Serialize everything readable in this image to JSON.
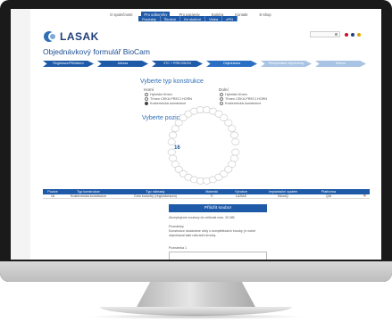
{
  "header": {
    "logo_text": "LASAK",
    "top_nav": [
      {
        "label": "O společnosti",
        "active": false
      },
      {
        "label": "Pro odborníky",
        "active": true
      },
      {
        "label": "Pro pacienty",
        "active": false
      },
      {
        "label": "Kariéra",
        "active": false
      },
      {
        "label": "Kontakt",
        "active": false
      },
      {
        "label": "E-shop",
        "active": false
      }
    ],
    "sub_nav": [
      "Produkty",
      "Školení",
      "Ke stažení",
      "Videa",
      "ePN"
    ],
    "languages": [
      {
        "name": "czech-flag-icon",
        "color": "#c8102e"
      },
      {
        "name": "uk-flag-icon",
        "color": "#1f3f7a"
      },
      {
        "name": "germany-flag-icon",
        "color": "#e2a400"
      }
    ]
  },
  "page_title": "Objednávkový formulář BioCam",
  "steps": [
    {
      "label": "Registrace/Přihlášení",
      "state": "done"
    },
    {
      "label": "Adresa",
      "state": "done"
    },
    {
      "label": "3TC + PRECISION",
      "state": "done"
    },
    {
      "label": "Objednávka",
      "state": "current"
    },
    {
      "label": "Rekapitulace objednávky",
      "state": "todo"
    },
    {
      "label": "Hotovo",
      "state": "todo"
    }
  ],
  "construction": {
    "title": "Vyberte typ konstrukce",
    "upper": {
      "heading": "Horní",
      "options": [
        {
          "label": "Hybridní třmen",
          "checked": false
        },
        {
          "label": "Třmen CEKA PRECI HORN",
          "checked": false
        },
        {
          "label": "Kostermická konstrukce",
          "checked": true
        }
      ]
    },
    "lower": {
      "heading": "Dolní",
      "options": [
        {
          "label": "Hybridní třmen",
          "checked": false
        },
        {
          "label": "Třmen CEKA PRECI HORN",
          "checked": false
        },
        {
          "label": "Kostermická konstrukce",
          "checked": false
        }
      ]
    }
  },
  "positions": {
    "title": "Vyberte pozici",
    "selected_tooth": "16"
  },
  "table": {
    "headers": [
      "Pozice",
      "Typ konstrukce",
      "Typ náhrady",
      "Materiál",
      "Výrobce",
      "Implantační systém",
      "Platforma"
    ],
    "rows": [
      [
        "16",
        "Kostermická konstrukce",
        "Čelo korunky (regio/dorsum)",
        "Ti",
        "LASAK",
        "BioniQ",
        "Q/6"
      ]
    ]
  },
  "attachments": {
    "title": "Přiložit soubor",
    "size_note": "Akceptujeme soubory do velikosti max. 20 MB.",
    "notes_heading": "Poznámky",
    "notes_text": "Konstrukce dodáváme vždy s komplettizační šrouby, je nutné objednávat také náhradní šrouby.",
    "field_label": "Poznámka 1"
  }
}
